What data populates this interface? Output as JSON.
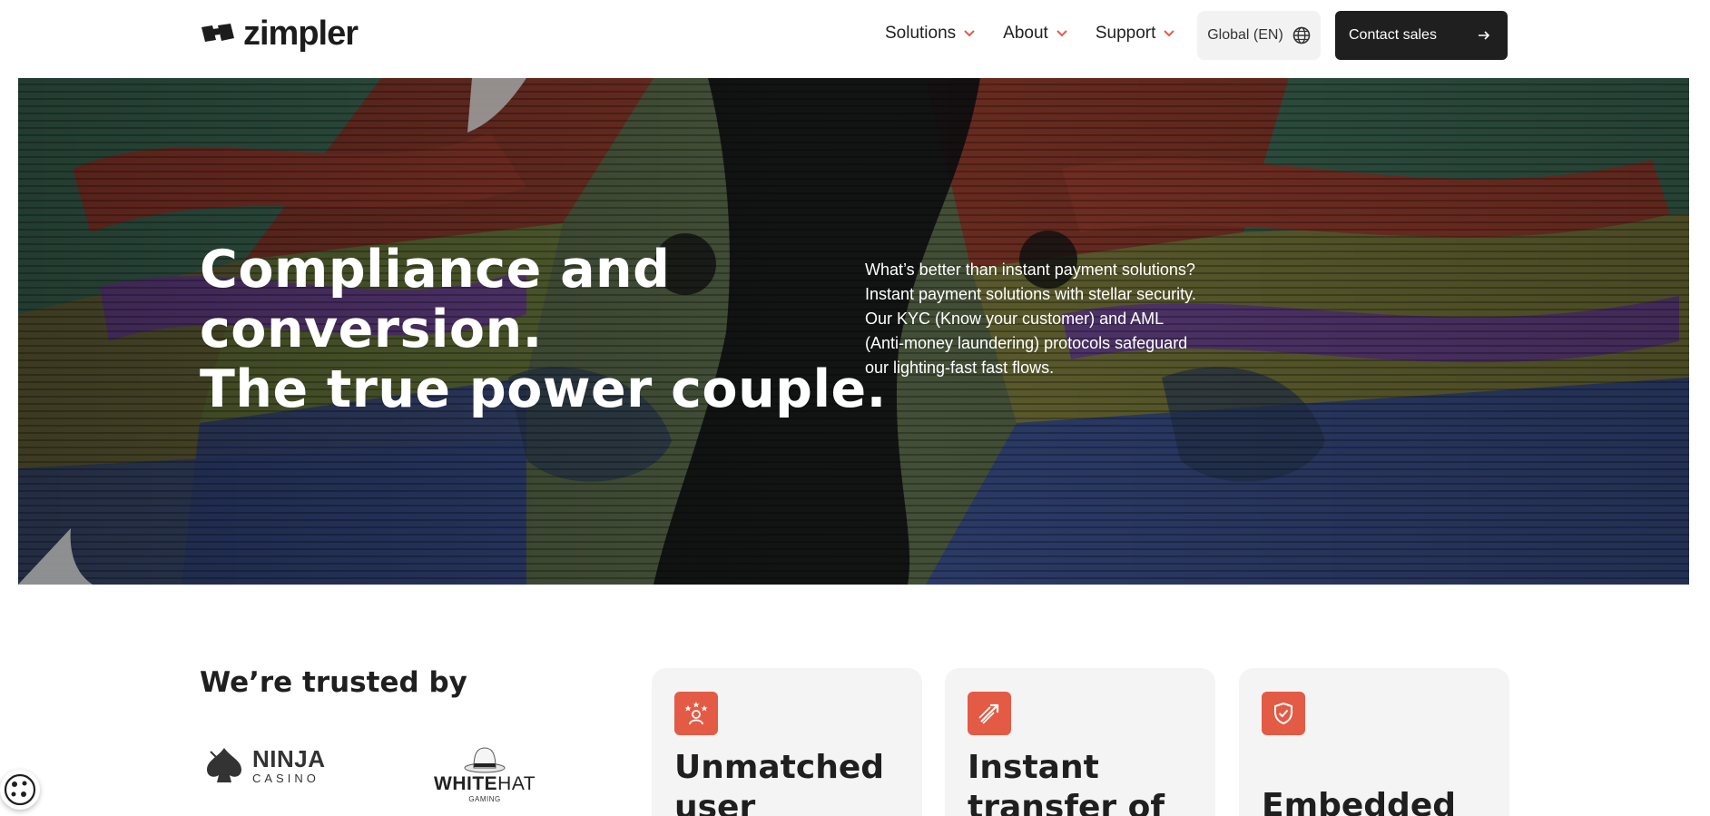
{
  "header": {
    "logo_text": "zimpler",
    "nav": [
      {
        "label": "Solutions"
      },
      {
        "label": "About"
      },
      {
        "label": "Support"
      }
    ],
    "locale_label": "Global (EN)",
    "contact_label": "Contact sales"
  },
  "hero": {
    "title_lines": [
      "Compliance and",
      "conversion.",
      "The true power couple."
    ],
    "description": "What’s better than instant payment solutions? Instant payment solutions with stellar security. Our KYC (Know your customer) and AML (Anti-money laundering) protocols safeguard our lighting-fast fast flows."
  },
  "trusted": {
    "title": "We’re trusted by",
    "partners": [
      {
        "main": "NINJA",
        "sub": "CASINO"
      },
      {
        "main_bold": "WHITE",
        "main_light": "HAT",
        "sub": "GAMING"
      }
    ]
  },
  "cards": [
    {
      "title_lines": [
        "Unmatched",
        "user"
      ],
      "icon": "users-star-icon"
    },
    {
      "title_lines": [
        "Instant",
        "transfer of"
      ],
      "icon": "fast-arrow-icon"
    },
    {
      "title_lines": [
        "Embedded"
      ],
      "icon": "shield-check-icon"
    }
  ],
  "colors": {
    "accent": "#e35b45",
    "dark": "#1f1f1f",
    "card_bg": "#f4f4f4"
  }
}
